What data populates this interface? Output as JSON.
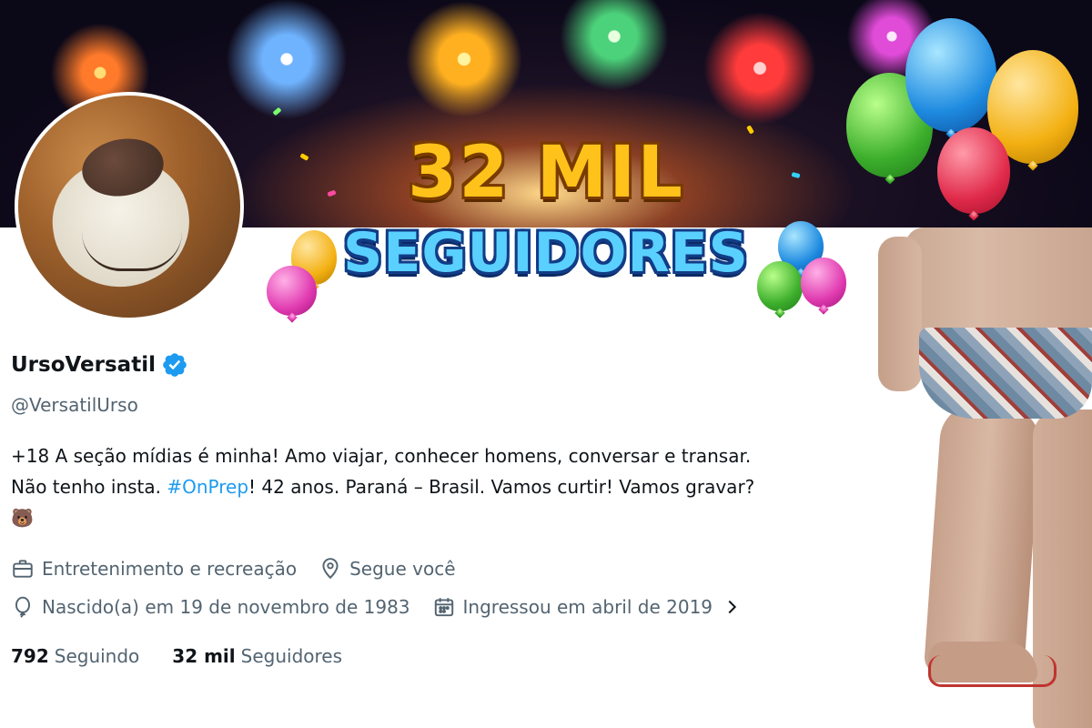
{
  "banner": {
    "headline": "32 MIL",
    "subline": "SEGUIDORES"
  },
  "profile": {
    "display_name": "UrsoVersatil",
    "handle": "@VersatilUrso",
    "verified": true,
    "bio": {
      "line1": "+18 A seção mídias é minha! Amo viajar, conhecer homens, conversar e transar.",
      "line2_before": "Não tenho insta. ",
      "hashtag": "#OnPrep",
      "line2_after": "! 42 anos. Paraná – Brasil. Vamos curtir! Vamos gravar?",
      "emoji": "🐻"
    },
    "category": "Entretenimento e recreação",
    "follows_you": "Segue você",
    "birthday": "Nascido(a) em 19 de novembro de 1983",
    "joined": "Ingressou em abril de 2019"
  },
  "stats": {
    "following_count": "792",
    "following_label": "Seguindo",
    "followers_count": "32 mil",
    "followers_label": "Seguidores"
  },
  "colors": {
    "accent": "#1d9bf0",
    "text_primary": "#0f1419",
    "text_secondary": "#536471"
  }
}
